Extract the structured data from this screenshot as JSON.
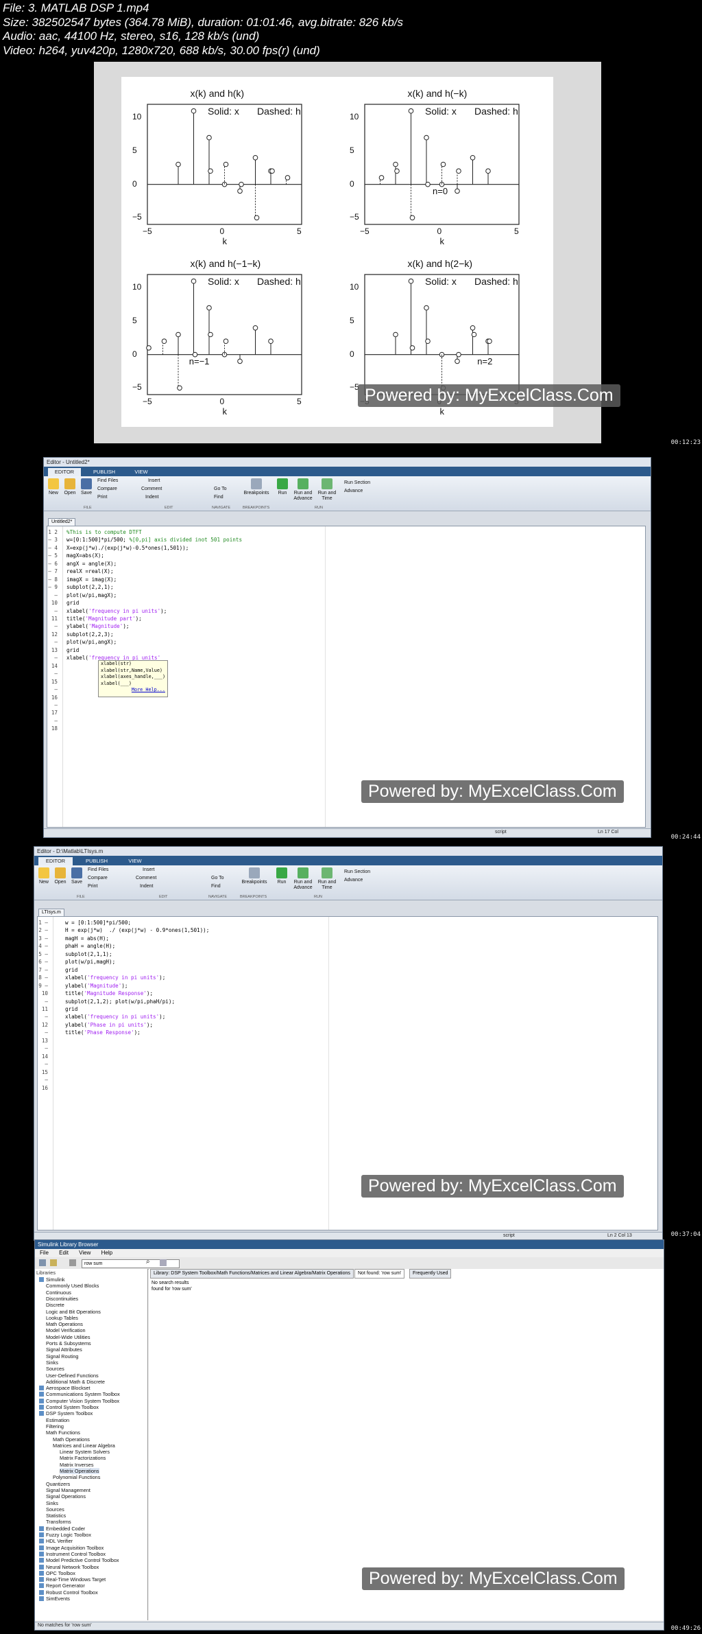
{
  "header": {
    "line1": "File: 3. MATLAB DSP 1.mp4",
    "line2": "Size: 382502547 bytes (364.78 MiB), duration: 01:01:46, avg.bitrate: 826 kb/s",
    "line3": "Audio: aac, 44100 Hz, stereo, s16, 128 kb/s (und)",
    "line4": "Video: h264, yuv420p, 1280x720, 688 kb/s, 30.00 fps(r) (und)"
  },
  "timestamps": [
    "00:12:23",
    "00:24:44",
    "00:37:04",
    "00:49:26"
  ],
  "watermark": "Powered by: MyExcelClass.Com",
  "slide": {
    "plots": [
      {
        "title": "x(k) and h(k)",
        "legend_solid": "Solid: x",
        "legend_dashed": "Dashed: h",
        "annotation": ""
      },
      {
        "title": "x(k) and h(−k)",
        "legend_solid": "Solid: x",
        "legend_dashed": "Dashed: h",
        "annotation": "n=0"
      },
      {
        "title": "x(k) and h(−1−k)",
        "legend_solid": "Solid: x",
        "legend_dashed": "Dashed: h",
        "annotation": "n=−1"
      },
      {
        "title": "x(k) and h(2−k)",
        "legend_solid": "Solid: x",
        "legend_dashed": "Dashed: h",
        "annotation": "n=2"
      }
    ],
    "yticks": [
      "10",
      "5",
      "0",
      "−5"
    ],
    "xticks": [
      "−5",
      "0",
      "5"
    ],
    "xlabel": "k"
  },
  "chart_data": [
    {
      "type": "scatter",
      "title": "x(k) and h(k)",
      "xlabel": "k",
      "xlim": [
        -5,
        5
      ],
      "ylim": [
        -6,
        12
      ],
      "series": [
        {
          "name": "Solid: x",
          "x": [
            -3,
            -2,
            -1,
            0,
            1,
            2,
            3
          ],
          "values": [
            3,
            11,
            7,
            0,
            -1,
            4,
            2
          ]
        },
        {
          "name": "Dashed: h",
          "x": [
            -1,
            0,
            1,
            2,
            3,
            4
          ],
          "values": [
            2,
            3,
            0,
            -5,
            2,
            1
          ]
        }
      ]
    },
    {
      "type": "scatter",
      "title": "x(k) and h(−k)",
      "xlabel": "k",
      "xlim": [
        -5,
        5
      ],
      "ylim": [
        -6,
        12
      ],
      "series": [
        {
          "name": "Solid: x",
          "x": [
            -3,
            -2,
            -1,
            0,
            1,
            2,
            3
          ],
          "values": [
            3,
            11,
            7,
            0,
            -1,
            4,
            2
          ]
        },
        {
          "name": "Dashed: h",
          "x": [
            -4,
            -3,
            -2,
            -1,
            0,
            1
          ],
          "values": [
            1,
            2,
            -5,
            0,
            3,
            2
          ]
        }
      ]
    },
    {
      "type": "scatter",
      "title": "x(k) and h(−1−k)",
      "xlabel": "k",
      "xlim": [
        -5,
        5
      ],
      "ylim": [
        -6,
        12
      ],
      "series": [
        {
          "name": "Solid: x",
          "x": [
            -3,
            -2,
            -1,
            0,
            1,
            2,
            3
          ],
          "values": [
            3,
            11,
            7,
            0,
            -1,
            4,
            2
          ]
        },
        {
          "name": "Dashed: h",
          "x": [
            -5,
            -4,
            -3,
            -2,
            -1,
            0
          ],
          "values": [
            1,
            2,
            -5,
            0,
            3,
            2
          ]
        }
      ]
    },
    {
      "type": "scatter",
      "title": "x(k) and h(2−k)",
      "xlabel": "k",
      "xlim": [
        -5,
        5
      ],
      "ylim": [
        -6,
        12
      ],
      "series": [
        {
          "name": "Solid: x",
          "x": [
            -3,
            -2,
            -1,
            0,
            1,
            2,
            3
          ],
          "values": [
            3,
            11,
            7,
            0,
            -1,
            4,
            2
          ]
        },
        {
          "name": "Dashed: h",
          "x": [
            -2,
            -1,
            0,
            1,
            2,
            3
          ],
          "values": [
            1,
            2,
            -5,
            0,
            3,
            2
          ]
        }
      ]
    }
  ],
  "editor1": {
    "title": "Editor - Untitled2*",
    "tabs": [
      "EDITOR",
      "PUBLISH",
      "VIEW"
    ],
    "doc_tab": "Untitled2*",
    "ribbon": {
      "new": "New",
      "open": "Open",
      "save": "Save",
      "find_files": "Find Files",
      "compare": "Compare",
      "print": "Print",
      "insert": "Insert",
      "comment": "Comment",
      "indent": "Indent",
      "goto": "Go To",
      "find": "Find",
      "breakpoints": "Breakpoints",
      "run": "Run",
      "run_advance": "Run and Advance",
      "run_time": "Run and Time",
      "run_section": "Run Section",
      "advance": "Advance"
    },
    "sections": [
      "FILE",
      "EDIT",
      "NAVIGATE",
      "BREAKPOINTS",
      "RUN"
    ],
    "popup": [
      "xlabel(str)",
      "xlabel(str,Name,Value)",
      "xlabel(axes_handle,___)",
      "xlabel(___)",
      "More Help..."
    ],
    "status": "script",
    "pos": "Ln  17   Col  "
  },
  "editor2": {
    "title": "Editor - D:\\Matlab\\LTIsys.m",
    "tabs": [
      "EDITOR",
      "PUBLISH",
      "VIEW"
    ],
    "doc_tab": "LTIsys.m",
    "status": "script",
    "pos": "Ln  2    Col  13"
  },
  "simulink": {
    "title": "Simulink Library Browser",
    "menu": [
      "File",
      "Edit",
      "View",
      "Help"
    ],
    "search": "row sum",
    "tabs": [
      "Library: DSP System Toolbox/Math Functions/Matrices and Linear Algebra/Matrix Operations",
      "Not found: 'row sum'",
      "Frequently Used"
    ],
    "results": [
      "No search results",
      "found for 'row sum'"
    ],
    "libraries_label": "Libraries",
    "status": "No matches for 'row sum'",
    "tree": [
      "Simulink",
      "Commonly Used Blocks",
      "Continuous",
      "Discontinuities",
      "Discrete",
      "Logic and Bit Operations",
      "Lookup Tables",
      "Math Operations",
      "Model Verification",
      "Model-Wide Utilities",
      "Ports & Subsystems",
      "Signal Attributes",
      "Signal Routing",
      "Sinks",
      "Sources",
      "User-Defined Functions",
      "Additional Math & Discrete",
      "Aerospace Blockset",
      "Communications System Toolbox",
      "Computer Vision System Toolbox",
      "Control System Toolbox",
      "DSP System Toolbox",
      "Estimation",
      "Filtering",
      "Math Functions",
      "Math Operations",
      "Matrices and Linear Algebra",
      "Linear System Solvers",
      "Matrix Factorizations",
      "Matrix Inverses",
      "Matrix Operations",
      "Polynomial Functions",
      "Quantizers",
      "Signal Management",
      "Signal Operations",
      "Sinks",
      "Sources",
      "Statistics",
      "Transforms",
      "Embedded Coder",
      "Fuzzy Logic Toolbox",
      "HDL Verifier",
      "Image Acquisition Toolbox",
      "Instrument Control Toolbox",
      "Model Predictive Control Toolbox",
      "Neural Network Toolbox",
      "OPC Toolbox",
      "Real-Time Windows Target",
      "Report Generator",
      "Robust Control Toolbox",
      "SimEvents"
    ]
  }
}
